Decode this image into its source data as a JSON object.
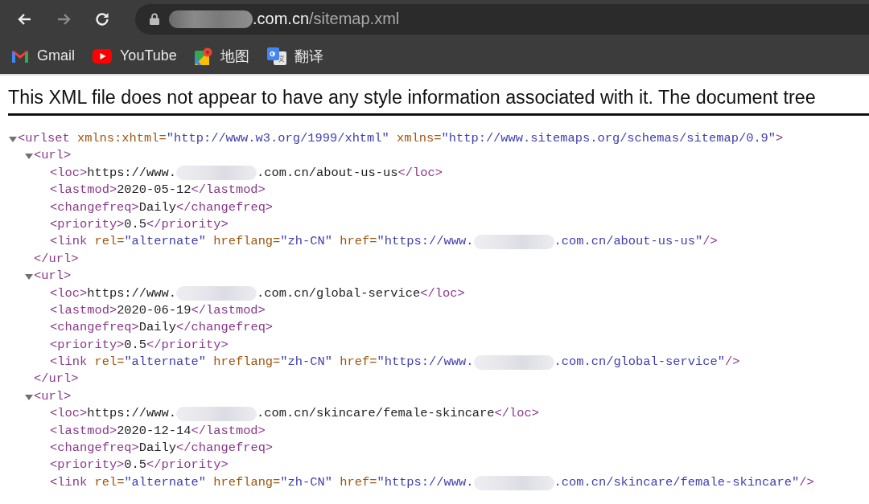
{
  "browser": {
    "nav_buttons": [
      {
        "kind": "back",
        "disabled": false
      },
      {
        "kind": "forward",
        "disabled": true
      },
      {
        "kind": "reload",
        "disabled": false
      }
    ],
    "address_bar": {
      "host": ".com.cn",
      "path": "/sitemap.xml"
    },
    "bookmarks": [
      {
        "kind": "gmail",
        "label": "Gmail"
      },
      {
        "kind": "youtube",
        "label": "YouTube"
      },
      {
        "kind": "maps",
        "label": "地图"
      },
      {
        "kind": "translate",
        "label": "翻译"
      }
    ]
  },
  "document": {
    "notice": "This XML file does not appear to have any style information associated with it. The document tree",
    "tree": {
      "expanded": true,
      "open": [
        {
          "kind": "tag",
          "text": "<urlset"
        },
        {
          "kind": "attr",
          "text": " xmlns:xhtml="
        },
        {
          "kind": "value",
          "text": "\"http://www.w3.org/1999/xhtml\""
        },
        {
          "kind": "attr",
          "text": " xmlns="
        },
        {
          "kind": "value",
          "text": "\"http://www.sitemaps.org/schemas/sitemap/0.9\""
        },
        {
          "kind": "tag",
          "text": ">"
        }
      ],
      "children": [
        {
          "expanded": true,
          "open": [
            {
              "kind": "tag",
              "text": "<url>"
            }
          ],
          "children": [
            {
              "tokens": [
                {
                  "kind": "tag",
                  "text": "<loc>"
                },
                {
                  "kind": "text",
                  "text": "https://www."
                },
                {
                  "kind": "redacted"
                },
                {
                  "kind": "text",
                  "text": ".com.cn/about-us-us"
                },
                {
                  "kind": "tag",
                  "text": "</loc>"
                }
              ]
            },
            {
              "tokens": [
                {
                  "kind": "tag",
                  "text": "<lastmod>"
                },
                {
                  "kind": "text",
                  "text": "2020-05-12"
                },
                {
                  "kind": "tag",
                  "text": "</lastmod>"
                }
              ]
            },
            {
              "tokens": [
                {
                  "kind": "tag",
                  "text": "<changefreq>"
                },
                {
                  "kind": "text",
                  "text": "Daily"
                },
                {
                  "kind": "tag",
                  "text": "</changefreq>"
                }
              ]
            },
            {
              "tokens": [
                {
                  "kind": "tag",
                  "text": "<priority>"
                },
                {
                  "kind": "text",
                  "text": "0.5"
                },
                {
                  "kind": "tag",
                  "text": "</priority>"
                }
              ]
            },
            {
              "tokens": [
                {
                  "kind": "tag",
                  "text": "<link"
                },
                {
                  "kind": "attr",
                  "text": " rel="
                },
                {
                  "kind": "value",
                  "text": "\"alternate\""
                },
                {
                  "kind": "attr",
                  "text": " hreflang="
                },
                {
                  "kind": "value",
                  "text": "\"zh-CN\""
                },
                {
                  "kind": "attr",
                  "text": " href="
                },
                {
                  "kind": "value",
                  "text": "\"https://www."
                },
                {
                  "kind": "redacted"
                },
                {
                  "kind": "value",
                  "text": ".com.cn/about-us-us\""
                },
                {
                  "kind": "tag",
                  "text": "/>"
                }
              ]
            }
          ],
          "close": [
            {
              "kind": "tag",
              "text": "</url>"
            }
          ]
        },
        {
          "expanded": true,
          "open": [
            {
              "kind": "tag",
              "text": "<url>"
            }
          ],
          "children": [
            {
              "tokens": [
                {
                  "kind": "tag",
                  "text": "<loc>"
                },
                {
                  "kind": "text",
                  "text": "https://www."
                },
                {
                  "kind": "redacted"
                },
                {
                  "kind": "text",
                  "text": ".com.cn/global-service"
                },
                {
                  "kind": "tag",
                  "text": "</loc>"
                }
              ]
            },
            {
              "tokens": [
                {
                  "kind": "tag",
                  "text": "<lastmod>"
                },
                {
                  "kind": "text",
                  "text": "2020-06-19"
                },
                {
                  "kind": "tag",
                  "text": "</lastmod>"
                }
              ]
            },
            {
              "tokens": [
                {
                  "kind": "tag",
                  "text": "<changefreq>"
                },
                {
                  "kind": "text",
                  "text": "Daily"
                },
                {
                  "kind": "tag",
                  "text": "</changefreq>"
                }
              ]
            },
            {
              "tokens": [
                {
                  "kind": "tag",
                  "text": "<priority>"
                },
                {
                  "kind": "text",
                  "text": "0.5"
                },
                {
                  "kind": "tag",
                  "text": "</priority>"
                }
              ]
            },
            {
              "tokens": [
                {
                  "kind": "tag",
                  "text": "<link"
                },
                {
                  "kind": "attr",
                  "text": " rel="
                },
                {
                  "kind": "value",
                  "text": "\"alternate\""
                },
                {
                  "kind": "attr",
                  "text": " hreflang="
                },
                {
                  "kind": "value",
                  "text": "\"zh-CN\""
                },
                {
                  "kind": "attr",
                  "text": " href="
                },
                {
                  "kind": "value",
                  "text": "\"https://www."
                },
                {
                  "kind": "redacted"
                },
                {
                  "kind": "value",
                  "text": ".com.cn/global-service\""
                },
                {
                  "kind": "tag",
                  "text": "/>"
                }
              ]
            }
          ],
          "close": [
            {
              "kind": "tag",
              "text": "</url>"
            }
          ]
        },
        {
          "expanded": true,
          "open": [
            {
              "kind": "tag",
              "text": "<url>"
            }
          ],
          "children": [
            {
              "tokens": [
                {
                  "kind": "tag",
                  "text": "<loc>"
                },
                {
                  "kind": "text",
                  "text": "https://www."
                },
                {
                  "kind": "redacted"
                },
                {
                  "kind": "text",
                  "text": ".com.cn/skincare/female-skincare"
                },
                {
                  "kind": "tag",
                  "text": "</loc>"
                }
              ]
            },
            {
              "tokens": [
                {
                  "kind": "tag",
                  "text": "<lastmod>"
                },
                {
                  "kind": "text",
                  "text": "2020-12-14"
                },
                {
                  "kind": "tag",
                  "text": "</lastmod>"
                }
              ]
            },
            {
              "tokens": [
                {
                  "kind": "tag",
                  "text": "<changefreq>"
                },
                {
                  "kind": "text",
                  "text": "Daily"
                },
                {
                  "kind": "tag",
                  "text": "</changefreq>"
                }
              ]
            },
            {
              "tokens": [
                {
                  "kind": "tag",
                  "text": "<priority>"
                },
                {
                  "kind": "text",
                  "text": "0.5"
                },
                {
                  "kind": "tag",
                  "text": "</priority>"
                }
              ]
            },
            {
              "tokens": [
                {
                  "kind": "tag",
                  "text": "<link"
                },
                {
                  "kind": "attr",
                  "text": " rel="
                },
                {
                  "kind": "value",
                  "text": "\"alternate\""
                },
                {
                  "kind": "attr",
                  "text": " hreflang="
                },
                {
                  "kind": "value",
                  "text": "\"zh-CN\""
                },
                {
                  "kind": "attr",
                  "text": " href="
                },
                {
                  "kind": "value",
                  "text": "\"https://www."
                },
                {
                  "kind": "redacted"
                },
                {
                  "kind": "value",
                  "text": ".com.cn/skincare/female-skincare\""
                },
                {
                  "kind": "tag",
                  "text": "/>"
                }
              ]
            }
          ]
        }
      ]
    }
  }
}
